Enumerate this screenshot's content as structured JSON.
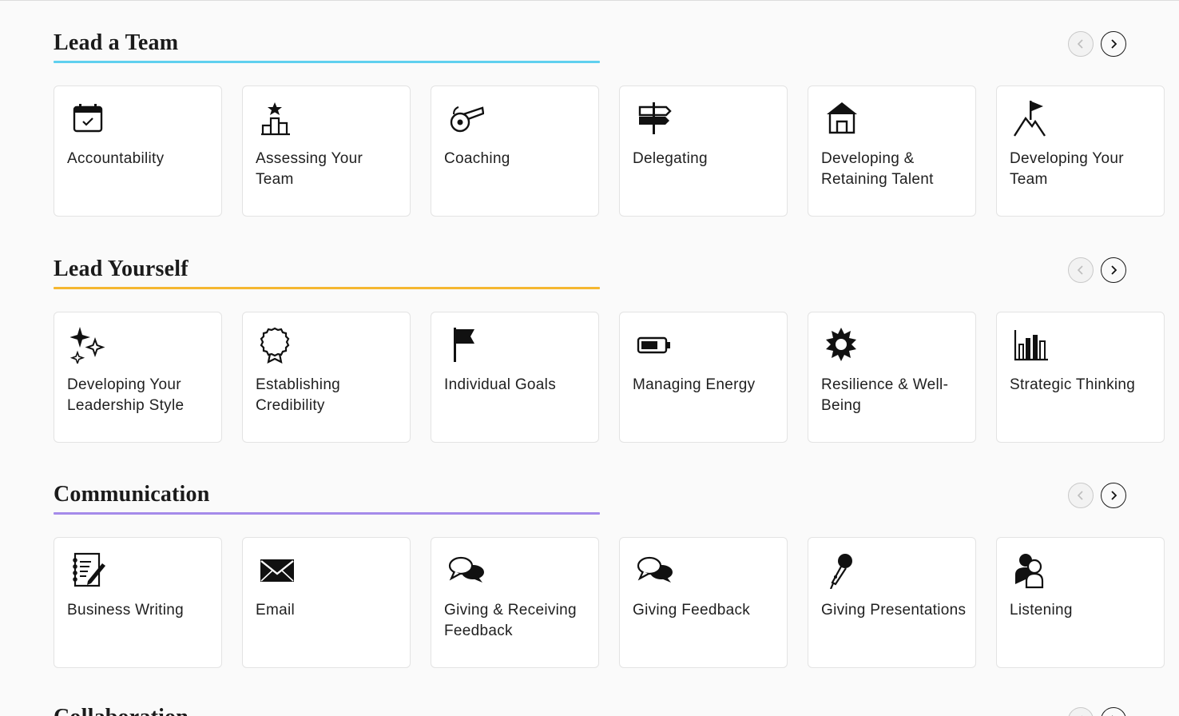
{
  "sections": [
    {
      "title": "Lead a Team",
      "accent": "#5fd0ef",
      "cards": [
        {
          "label": "Accountability",
          "icon": "calendar-check-icon"
        },
        {
          "label": "Assessing Your Team",
          "icon": "podium-star-icon"
        },
        {
          "label": "Coaching",
          "icon": "whistle-icon"
        },
        {
          "label": "Delegating",
          "icon": "signpost-icon"
        },
        {
          "label": "Developing & Retaining Talent",
          "icon": "house-icon"
        },
        {
          "label": "Developing Your Team",
          "icon": "mountain-flag-icon"
        }
      ]
    },
    {
      "title": "Lead Yourself",
      "accent": "#f5b731",
      "cards": [
        {
          "label": "Developing Your Leadership Style",
          "icon": "sparkles-icon"
        },
        {
          "label": "Establishing Credibility",
          "icon": "award-ribbon-icon"
        },
        {
          "label": "Individual Goals",
          "icon": "flag-icon"
        },
        {
          "label": "Managing Energy",
          "icon": "battery-icon"
        },
        {
          "label": "Resilience & Well-Being",
          "icon": "sun-icon"
        },
        {
          "label": "Strategic Thinking",
          "icon": "bar-chart-icon"
        }
      ]
    },
    {
      "title": "Communication",
      "accent": "#a58bea",
      "cards": [
        {
          "label": "Business Writing",
          "icon": "notepad-pen-icon"
        },
        {
          "label": "Email",
          "icon": "envelope-icon"
        },
        {
          "label": "Giving & Receiving Feedback",
          "icon": "speech-bubbles-icon"
        },
        {
          "label": "Giving Feedback",
          "icon": "speech-bubbles-icon"
        },
        {
          "label": "Giving Presentations",
          "icon": "microphone-icon"
        },
        {
          "label": "Listening",
          "icon": "people-icon"
        }
      ]
    },
    {
      "title": "Collaboration",
      "accent": "#cccccc",
      "cards": []
    }
  ],
  "nav": {
    "prev_icon": "chevron-left-icon",
    "next_icon": "chevron-right-icon"
  }
}
